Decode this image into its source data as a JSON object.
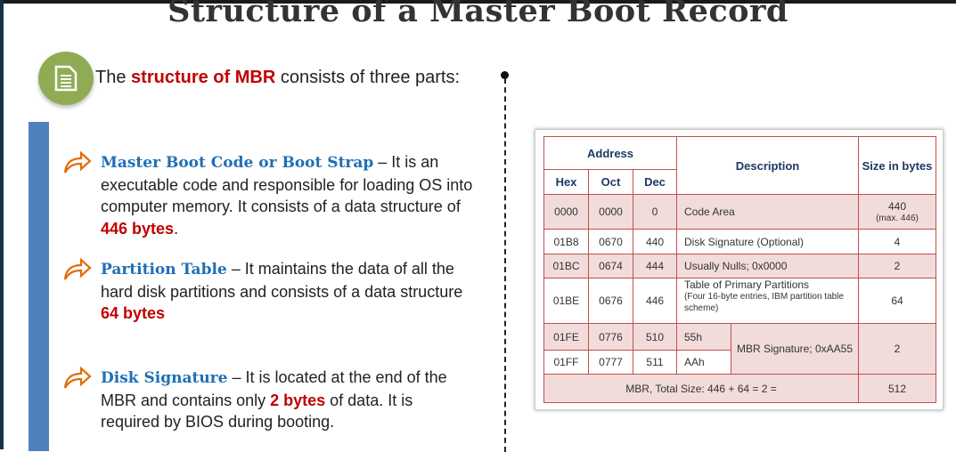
{
  "title": "Structure of a Master Boot Record",
  "intro": {
    "pre": "The ",
    "highlight": "structure of MBR",
    "post": " consists of three parts:"
  },
  "bullets": [
    {
      "heading": "Master Boot Code or Boot Strap",
      "text1": " – It is an executable code and responsible for loading OS into computer memory. It consists of a data structure of ",
      "bold": "446 bytes",
      "text2": "."
    },
    {
      "heading": "Partition Table",
      "text1": " – It maintains the data of all the hard disk partitions and consists of a data structure ",
      "bold": "64 bytes",
      "text2": ""
    },
    {
      "heading": "Disk Signature",
      "text1": " – It is located at the end of the MBR and contains only ",
      "bold": "2 bytes",
      "text2": " of data. It is required by BIOS during booting."
    }
  ],
  "table": {
    "headers": {
      "address": "Address",
      "hex": "Hex",
      "oct": "Oct",
      "dec": "Dec",
      "description": "Description",
      "size": "Size in bytes"
    },
    "rows": [
      {
        "hex": "0000",
        "oct": "0000",
        "dec": "0",
        "desc": "Code Area",
        "size": "440",
        "size_note": "(max. 446)"
      },
      {
        "hex": "01B8",
        "oct": "0670",
        "dec": "440",
        "desc": "Disk Signature (Optional)",
        "size": "4"
      },
      {
        "hex": "01BC",
        "oct": "0674",
        "dec": "444",
        "desc": "Usually Nulls; 0x0000",
        "size": "2"
      },
      {
        "hex": "01BE",
        "oct": "0676",
        "dec": "446",
        "desc": "Table of Primary Partitions",
        "desc_note": "(Four 16-byte entries, IBM partition table scheme)",
        "size": "64"
      },
      {
        "hex": "01FE",
        "oct": "0776",
        "dec": "510",
        "desc": "55h"
      },
      {
        "hex": "01FF",
        "oct": "0777",
        "dec": "511",
        "desc": "AAh"
      }
    ],
    "signature": "MBR Signature; 0xAA55",
    "signature_size": "2",
    "total_label": "MBR, Total Size: 446 + 64 = 2 =",
    "total": "512"
  }
}
